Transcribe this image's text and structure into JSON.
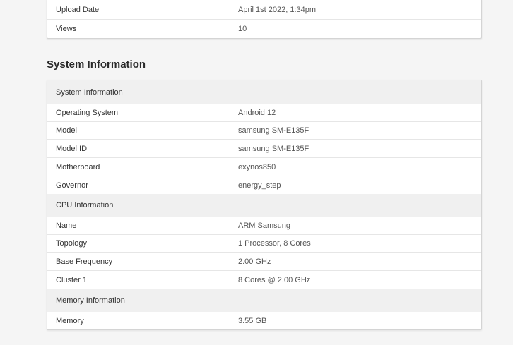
{
  "top_table": {
    "rows": [
      {
        "label": "Upload Date",
        "value": "April 1st 2022, 1:34pm"
      },
      {
        "label": "Views",
        "value": "10"
      }
    ]
  },
  "system_section": {
    "title": "System Information",
    "groups": [
      {
        "header": "System Information",
        "rows": [
          {
            "label": "Operating System",
            "value": "Android 12"
          },
          {
            "label": "Model",
            "value": "samsung SM-E135F"
          },
          {
            "label": "Model ID",
            "value": "samsung SM-E135F"
          },
          {
            "label": "Motherboard",
            "value": "exynos850"
          },
          {
            "label": "Governor",
            "value": "energy_step"
          }
        ]
      },
      {
        "header": "CPU Information",
        "rows": [
          {
            "label": "Name",
            "value": "ARM Samsung"
          },
          {
            "label": "Topology",
            "value": "1 Processor, 8 Cores"
          },
          {
            "label": "Base Frequency",
            "value": "2.00 GHz"
          },
          {
            "label": "Cluster 1",
            "value": "8 Cores @ 2.00 GHz"
          }
        ]
      },
      {
        "header": "Memory Information",
        "rows": [
          {
            "label": "Memory",
            "value": "3.55 GB"
          }
        ]
      }
    ]
  }
}
